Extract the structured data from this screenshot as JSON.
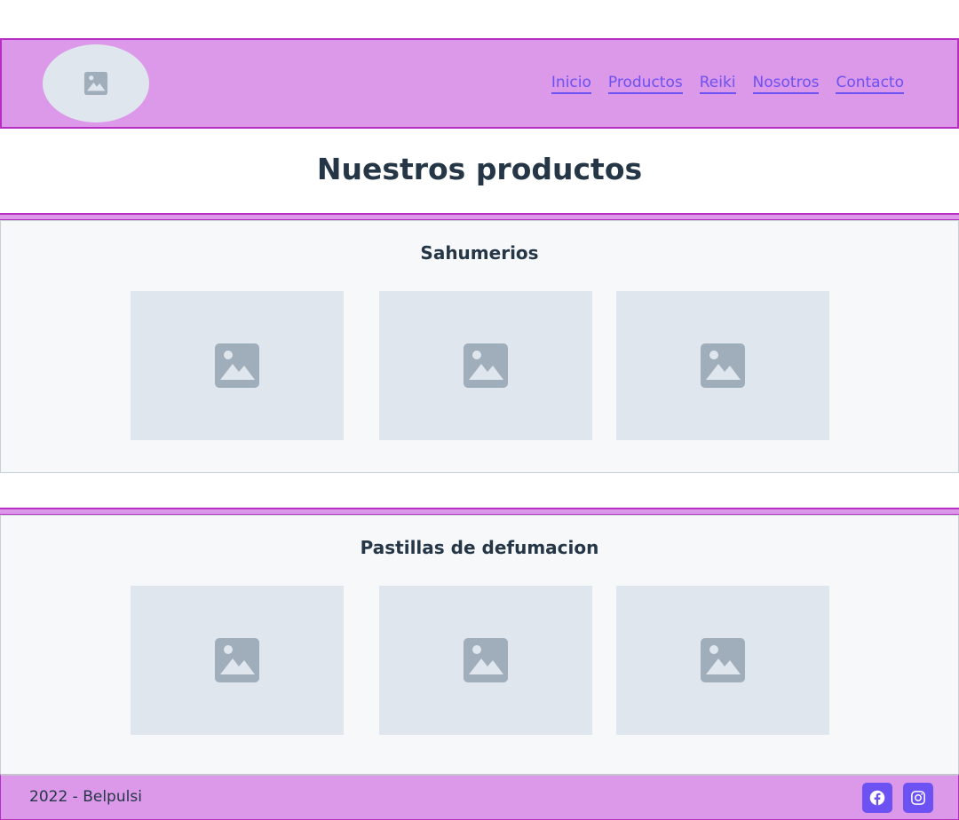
{
  "header": {
    "logo_icon": "image-placeholder-icon",
    "nav": [
      {
        "label": "Inicio"
      },
      {
        "label": "Productos"
      },
      {
        "label": "Reiki"
      },
      {
        "label": "Nosotros"
      },
      {
        "label": "Contacto"
      }
    ]
  },
  "main": {
    "title": "Nuestros productos",
    "sections": [
      {
        "title": "Sahumerios",
        "image_icon": "image-placeholder-icon",
        "product_count": 3
      },
      {
        "title": "Pastillas de defumacion",
        "image_icon": "image-placeholder-icon",
        "product_count": 3
      }
    ]
  },
  "footer": {
    "copyright": "2022 - Belpulsi",
    "social": [
      {
        "icon": "facebook-icon"
      },
      {
        "icon": "instagram-icon"
      }
    ]
  },
  "colors": {
    "accent": "#6c52f2",
    "band": "#dc98e9",
    "band_border": "#b62fc2",
    "placeholder": "#e0e6ee",
    "placeholder_icon": "#a0aebb",
    "text": "#253746"
  }
}
